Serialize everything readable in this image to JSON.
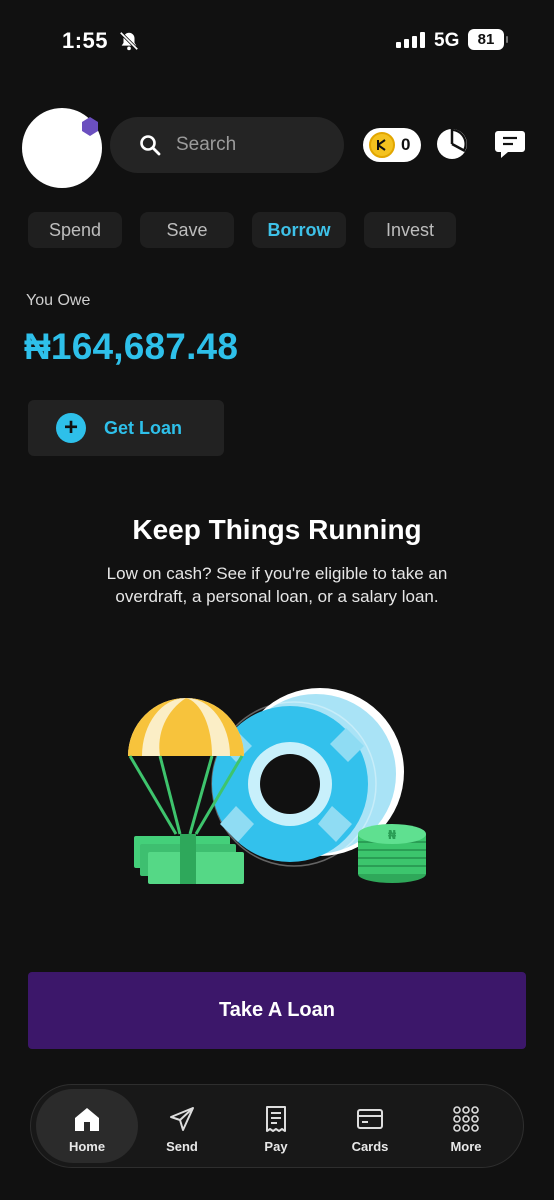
{
  "status_bar": {
    "time": "1:55",
    "network": "5G",
    "battery": "81"
  },
  "header": {
    "search_placeholder": "Search",
    "coin_count": "0"
  },
  "tabs": [
    {
      "label": "Spend"
    },
    {
      "label": "Save"
    },
    {
      "label": "Borrow",
      "active": true
    },
    {
      "label": "Invest"
    }
  ],
  "balance": {
    "label": "You Owe",
    "amount": "₦164,687.48"
  },
  "get_loan": {
    "label": "Get Loan"
  },
  "promo": {
    "title": "Keep Things Running",
    "subtitle": "Low on cash? See if you're eligible to take an overdraft, a personal loan, or a salary loan."
  },
  "cta": {
    "label": "Take A Loan"
  },
  "bottom_nav": [
    {
      "label": "Home",
      "icon": "home-icon",
      "active": true
    },
    {
      "label": "Send",
      "icon": "send-icon"
    },
    {
      "label": "Pay",
      "icon": "receipt-icon"
    },
    {
      "label": "Cards",
      "icon": "card-icon"
    },
    {
      "label": "More",
      "icon": "grid-icon"
    }
  ],
  "colors": {
    "accent": "#2ec0ea",
    "cta": "#3c176a",
    "background": "#111111"
  }
}
